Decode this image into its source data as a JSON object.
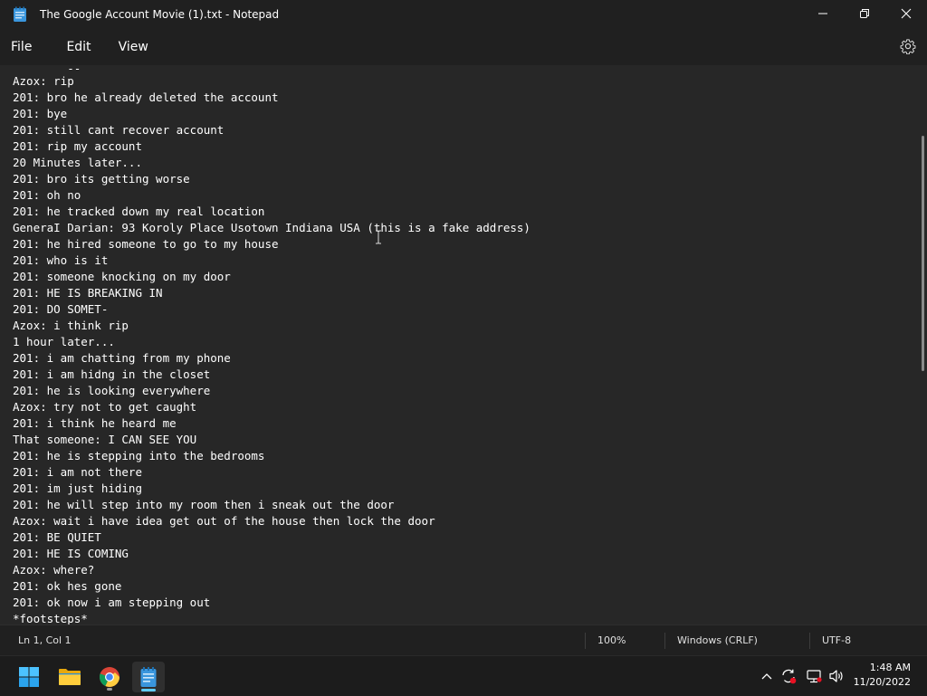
{
  "window": {
    "title": "The Google Account Movie (1).txt - Notepad"
  },
  "menu": {
    "file": "File",
    "edit": "Edit",
    "view": "View"
  },
  "editor": {
    "cut_line": "        --",
    "lines": [
      "Azox: rip",
      "201: bro he already deleted the account",
      "201: bye",
      "201: still cant recover account",
      "201: rip my account",
      "20 Minutes later...",
      "201: bro its getting worse",
      "201: oh no",
      "201: he tracked down my real location",
      "GeneraI Darian: 93 Koroly Place Usotown Indiana USA (this is a fake address)",
      "201: he hired someone to go to my house",
      "201: who is it",
      "201: someone knocking on my door",
      "201: HE IS BREAKING IN",
      "201: DO SOMET-",
      "Azox: i think rip",
      "1 hour later...",
      "201: i am chatting from my phone",
      "201: i am hidng in the closet",
      "201: he is looking everywhere",
      "Azox: try not to get caught",
      "201: i think he heard me",
      "That someone: I CAN SEE YOU",
      "201: he is stepping into the bedrooms",
      "201: i am not there",
      "201: im just hiding",
      "201: he will step into my room then i sneak out the door",
      "Azox: wait i have idea get out of the house then lock the door",
      "201: BE QUIET",
      "201: HE IS COMING",
      "Azox: where?",
      "201: ok hes gone",
      "201: ok now i am stepping out",
      "*footsteps*"
    ]
  },
  "status": {
    "position": "Ln 1, Col 1",
    "zoom": "100%",
    "line_ending": "Windows (CRLF)",
    "encoding": "UTF-8"
  },
  "clock": {
    "time": "1:48 AM",
    "date": "11/20/2022"
  },
  "colors": {
    "accent": "#60cdff",
    "editor_bg": "#272727",
    "chrome_bg": "#202020"
  }
}
